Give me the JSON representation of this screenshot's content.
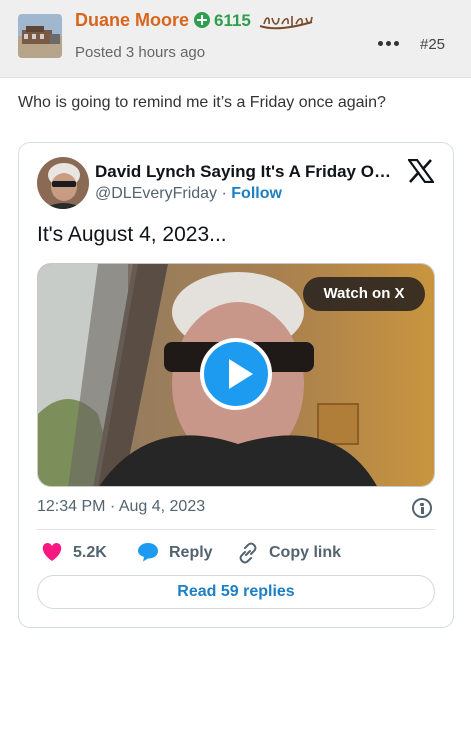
{
  "post": {
    "author": "Duane Moore",
    "reputation": "6115",
    "posted_time": "Posted 3 hours ago",
    "post_number": "#25",
    "body_text": "Who is going to remind me it’s a Friday once again?"
  },
  "tweet": {
    "display_name": "David Lynch Saying It's A Friday On...",
    "handle": "@DLEveryFriday",
    "separator": " · ",
    "follow_label": "Follow",
    "text": "It's August 4, 2023...",
    "watch_label": "Watch on X",
    "timestamp": "12:34 PM · Aug 4, 2023",
    "likes_count": "5.2K",
    "reply_label": "Reply",
    "copy_link_label": "Copy link",
    "read_replies_label": "Read 59 replies"
  },
  "icons": {
    "reputation": "plus-circle-icon",
    "more": "ellipsis-icon",
    "brand": "x-logo-icon",
    "play": "play-icon",
    "info": "info-icon",
    "like": "heart-icon",
    "reply": "speech-bubble-icon",
    "copy": "link-icon"
  },
  "colors": {
    "author": "#d9651c",
    "reputation": "#2e9e4f",
    "link": "#1d7fc4",
    "play": "#1d9bf0",
    "like": "#f91880"
  }
}
